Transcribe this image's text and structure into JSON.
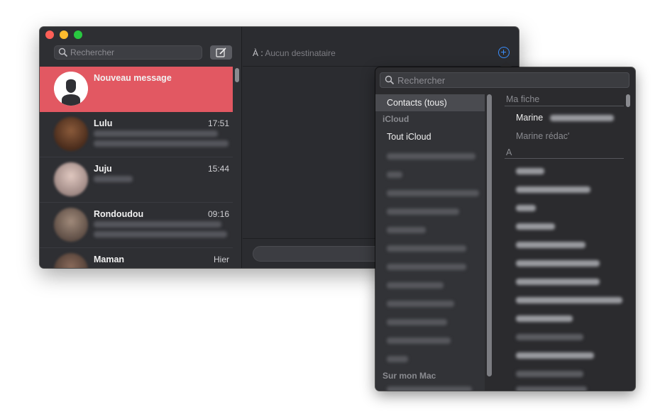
{
  "messages_window": {
    "search_placeholder": "Rechercher",
    "conversations": [
      {
        "name": "Nouveau message",
        "time": "",
        "active": true
      },
      {
        "name": "Lulu",
        "time": "17:51",
        "active": false
      },
      {
        "name": "Juju",
        "time": "15:44",
        "active": false
      },
      {
        "name": "Rondoudou",
        "time": "09:16",
        "active": false
      },
      {
        "name": "Maman",
        "time": "Hier",
        "active": false
      }
    ],
    "to_label": "À :",
    "to_placeholder": "Aucun destinataire"
  },
  "contacts_popover": {
    "search_placeholder": "Rechercher",
    "groups_selected": "Contacts (tous)",
    "groups_header_icloud": "iCloud",
    "group_all_icloud": "Tout iCloud",
    "groups_header_mac": "Sur mon Mac",
    "my_card_header": "Ma fiche",
    "my_card_name": "Marine",
    "my_card_name_alt": "Marine rédac'",
    "section_a": "A"
  },
  "colors": {
    "accent_red": "#e25862",
    "accent_blue": "#3a8efc",
    "window_bg": "#2b2c30"
  }
}
